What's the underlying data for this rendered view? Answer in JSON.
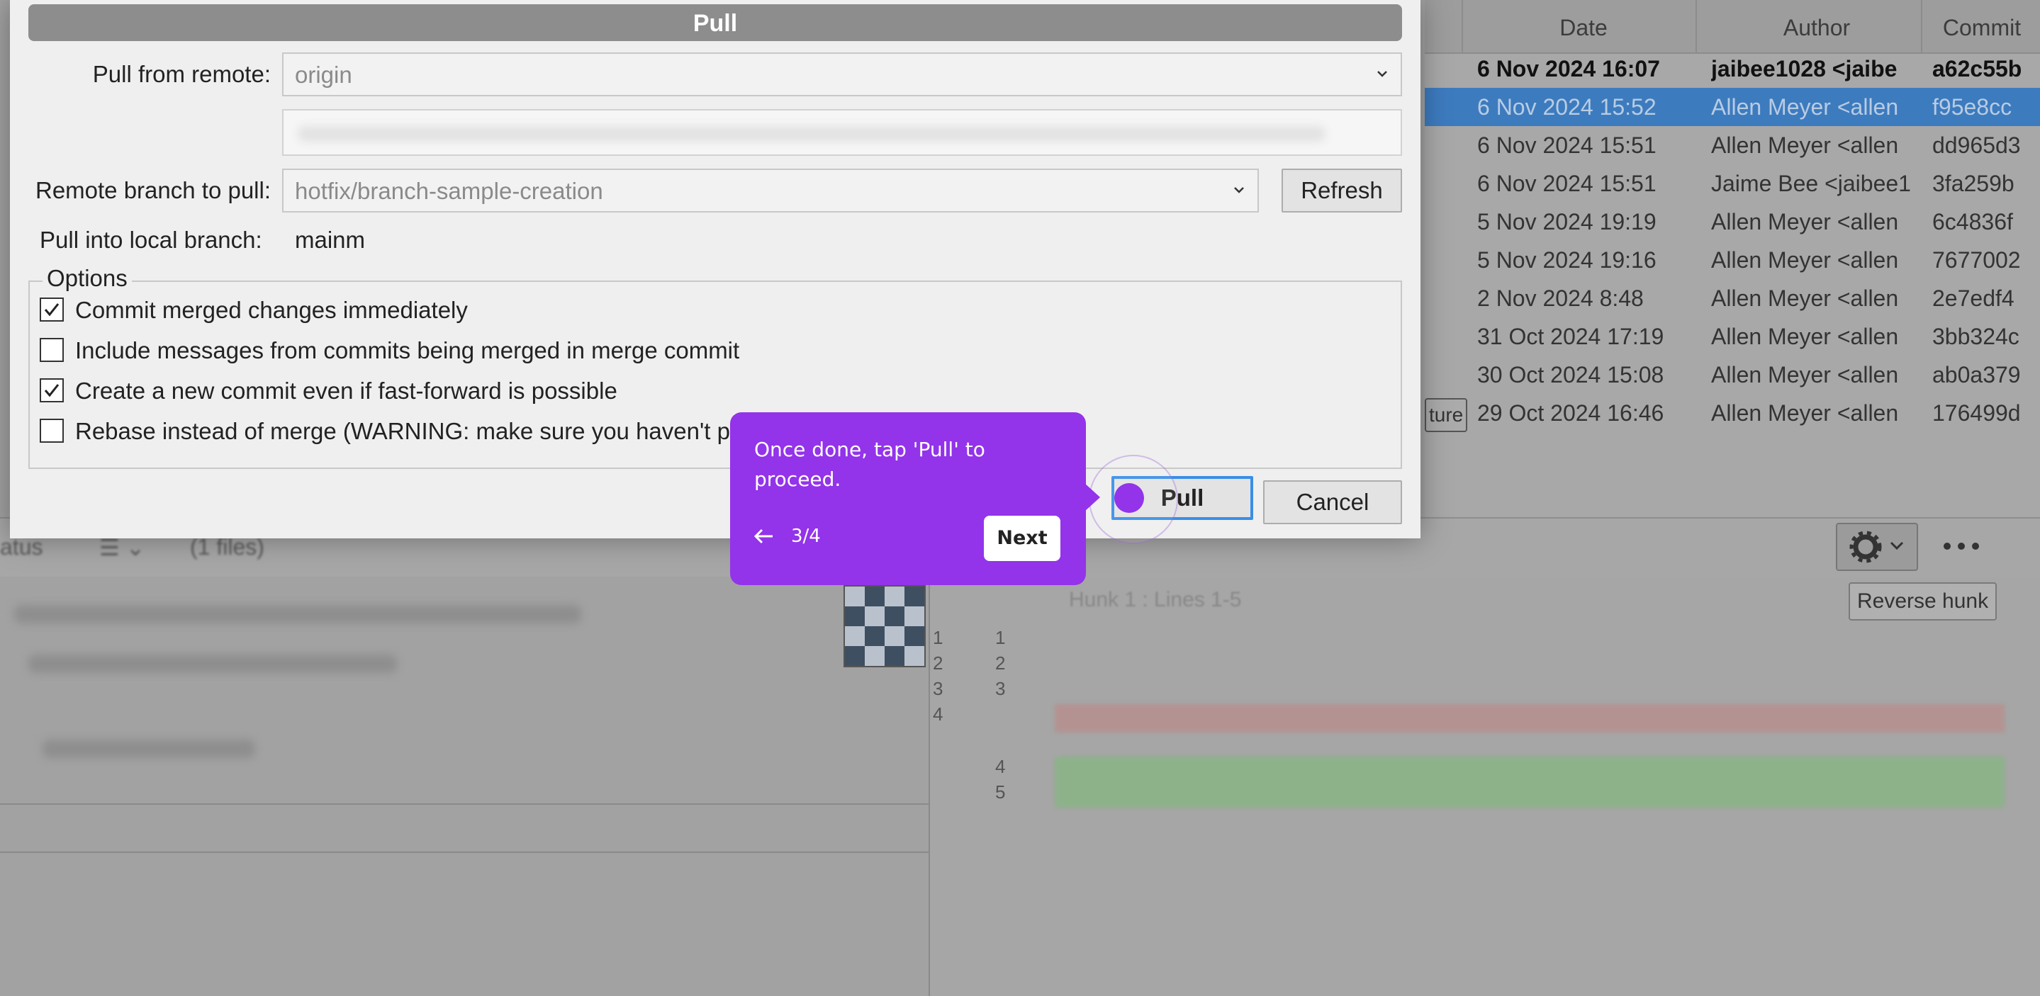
{
  "commit_table": {
    "headers": {
      "date": "Date",
      "author": "Author",
      "commit": "Commit"
    },
    "rows": [
      {
        "date": "6 Nov 2024 16:07",
        "author": "jaibee1028 <jaibe",
        "commit": "a62c55b",
        "style": "bold"
      },
      {
        "date": "6 Nov 2024 15:52",
        "author": "Allen Meyer <allen",
        "commit": "f95e8cc",
        "style": "selected"
      },
      {
        "date": "6 Nov 2024 15:51",
        "author": "Allen Meyer <allen",
        "commit": "dd965d3",
        "style": ""
      },
      {
        "date": "6 Nov 2024 15:51",
        "author": "Jaime Bee <jaibee1",
        "commit": "3fa259b",
        "style": ""
      },
      {
        "date": "5 Nov 2024 19:19",
        "author": "Allen Meyer <allen",
        "commit": "6c4836f",
        "style": ""
      },
      {
        "date": "5 Nov 2024 19:16",
        "author": "Allen Meyer <allen",
        "commit": "7677002",
        "style": ""
      },
      {
        "date": "2 Nov 2024 8:48",
        "author": "Allen Meyer <allen",
        "commit": "2e7edf4",
        "style": ""
      },
      {
        "date": "31 Oct 2024 17:19",
        "author": "Allen Meyer <allen",
        "commit": "3bb324c",
        "style": ""
      },
      {
        "date": "30 Oct 2024 15:08",
        "author": "Allen Meyer <allen",
        "commit": "ab0a379",
        "style": ""
      },
      {
        "date": "29 Oct 2024 16:46",
        "author": "Allen Meyer <allen",
        "commit": "176499d",
        "style": ""
      }
    ],
    "branch_fragment": "ture"
  },
  "lower_toolbar": {
    "status_text": "atus",
    "files_text": "(1 files)"
  },
  "diff": {
    "hunk_header": "Hunk 1 : Lines 1-5",
    "reverse_hunk_label": "Reverse hunk",
    "left_line_numbers": [
      "1",
      "2",
      "3",
      "4"
    ],
    "right_line_numbers_top": [
      "1",
      "2",
      "3"
    ],
    "right_line_numbers_bottom": [
      "4",
      "5"
    ]
  },
  "dialog": {
    "title": "Pull",
    "pull_from_remote_label": "Pull from remote:",
    "pull_from_remote_value": "origin",
    "remote_branch_label": "Remote branch to pull:",
    "remote_branch_value": "hotfix/branch-sample-creation",
    "refresh_label": "Refresh",
    "local_branch_label": "Pull into local branch:",
    "local_branch_value": "mainm",
    "options_legend": "Options",
    "options": [
      {
        "label": "Commit merged changes immediately",
        "checked": true
      },
      {
        "label": "Include messages from commits being merged in merge commit",
        "checked": false
      },
      {
        "label": "Create a new commit even if fast-forward is possible",
        "checked": true
      },
      {
        "label": "Rebase instead of merge (WARNING: make sure you haven't p",
        "checked": false
      }
    ],
    "pull_button": "Pull",
    "cancel_button": "Cancel"
  },
  "tooltip": {
    "text": "Once done, tap 'Pull' to proceed.",
    "step": "3/4",
    "next_label": "Next",
    "color": "#9333ea"
  }
}
